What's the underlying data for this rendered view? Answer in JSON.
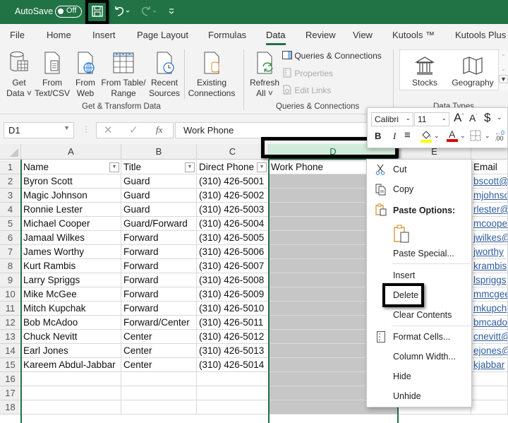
{
  "titlebar": {
    "autosave_label": "AutoSave",
    "autosave_state": "Off",
    "accent": "#217346"
  },
  "tabs": [
    "File",
    "Home",
    "Insert",
    "Page Layout",
    "Formulas",
    "Data",
    "Review",
    "View",
    "Kutools ™",
    "Kutools Plus"
  ],
  "active_tab": "Data",
  "ribbon": {
    "get_transform": {
      "buttons": [
        {
          "line1": "Get",
          "line2": "Data ˅",
          "icon": "database-icon"
        },
        {
          "line1": "From",
          "line2": "Text/CSV",
          "icon": "text-file-icon"
        },
        {
          "line1": "From",
          "line2": "Web",
          "icon": "web-icon"
        },
        {
          "line1": "From Table/",
          "line2": "Range",
          "icon": "table-icon"
        },
        {
          "line1": "Recent",
          "line2": "Sources",
          "icon": "clock-file-icon"
        },
        {
          "line1": "Existing",
          "line2": "Connections",
          "icon": "connections-icon"
        }
      ],
      "label": "Get & Transform Data"
    },
    "queries": {
      "refresh_line1": "Refresh",
      "refresh_line2": "All ˅",
      "queries_connections": "Queries & Connections",
      "properties": "Properties",
      "edit_links": "Edit Links",
      "label": "Queries & Connections"
    },
    "data_types": {
      "stocks": "Stocks",
      "geography": "Geography",
      "label": "Data Types"
    }
  },
  "formula_bar": {
    "name_box": "D1",
    "formula": "Work Phone",
    "fx": "fx"
  },
  "mini_toolbar": {
    "font": "Calibri",
    "size": "11"
  },
  "columns": [
    "A",
    "B",
    "C",
    "D",
    "E"
  ],
  "headers": [
    "Name",
    "Title",
    "Direct Phone",
    "Work Phone",
    "Email"
  ],
  "rows": [
    [
      "Byron Scott",
      "Guard",
      "(310) 426-5001",
      "",
      "bscott@"
    ],
    [
      "Magic Johnson",
      "Guard",
      "(310) 426-5002",
      "",
      "mjohnso"
    ],
    [
      "Ronnie Lester",
      "Guard",
      "(310) 426-5003",
      "",
      "rlester@"
    ],
    [
      "Michael Cooper",
      "Guard/Forward",
      "(310) 426-5004",
      "",
      "mcoope"
    ],
    [
      "Jamaal Wilkes",
      "Forward",
      "(310) 426-5005",
      "",
      "jwilkes@"
    ],
    [
      "James Worthy",
      "Forward",
      "(310) 426-5006",
      "",
      "jworthy"
    ],
    [
      "Kurt Rambis",
      "Forward",
      "(310) 426-5007",
      "",
      "krambis"
    ],
    [
      "Larry Spriggs",
      "Forward",
      "(310) 426-5008",
      "",
      "lspriggs"
    ],
    [
      "Mike McGee",
      "Forward",
      "(310) 426-5009",
      "",
      "mmcgee"
    ],
    [
      "Mitch Kupchak",
      "Forward",
      "(310) 426-5010",
      "",
      "mkupch"
    ],
    [
      "Bob McAdoo",
      "Forward/Center",
      "(310) 426-5011",
      "",
      "bmcado"
    ],
    [
      "Chuck Nevitt",
      "Center",
      "(310) 426-5012",
      "",
      "cnevitt@"
    ],
    [
      "Earl Jones",
      "Center",
      "(310) 426-5013",
      "",
      "ejones@"
    ],
    [
      "Kareem Abdul-Jabbar",
      "Center",
      "(310) 426-5014",
      "",
      "kjabbar"
    ]
  ],
  "row_numbers": [
    "1",
    "2",
    "3",
    "4",
    "5",
    "6",
    "7",
    "8",
    "9",
    "10",
    "11",
    "12",
    "13",
    "14",
    "15",
    "16",
    "17",
    "18"
  ],
  "context_menu": {
    "cut": "Cut",
    "copy": "Copy",
    "paste_options": "Paste Options:",
    "paste_special": "Paste Special...",
    "insert": "Insert",
    "delete": "Delete",
    "clear_contents": "Clear Contents",
    "format_cells": "Format Cells...",
    "column_width": "Column Width...",
    "hide": "Hide",
    "unhide": "Unhide"
  }
}
